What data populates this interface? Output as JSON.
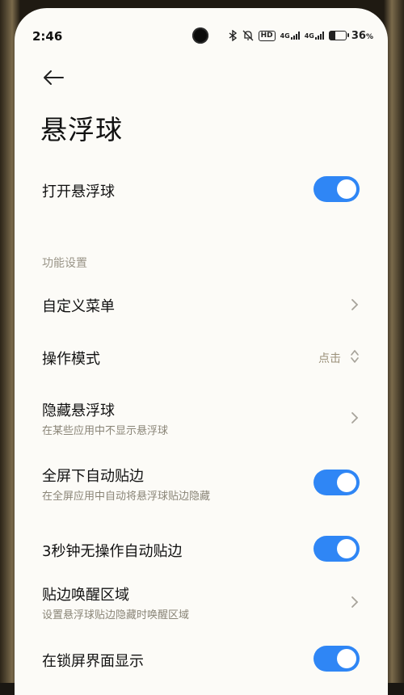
{
  "status_bar": {
    "time": "2:46",
    "hd": "HD",
    "sig1": "4G",
    "sig2": "4G",
    "battery": "36"
  },
  "page": {
    "title": "悬浮球"
  },
  "main_toggle": {
    "label": "打开悬浮球",
    "on": true
  },
  "section": {
    "title": "功能设置"
  },
  "items": [
    {
      "label": "自定义菜单",
      "type": "link"
    },
    {
      "label": "操作模式",
      "type": "select",
      "value": "点击"
    },
    {
      "label": "隐藏悬浮球",
      "subtitle": "在某些应用中不显示悬浮球",
      "type": "link"
    },
    {
      "label": "全屏下自动贴边",
      "subtitle": "在全屏应用中自动将悬浮球贴边隐藏",
      "type": "toggle",
      "on": true
    },
    {
      "label": "3秒钟无操作自动贴边",
      "type": "toggle",
      "on": true
    },
    {
      "label": "贴边唤醒区域",
      "subtitle": "设置悬浮球贴边隐藏时唤醒区域",
      "type": "link"
    },
    {
      "label": "在锁屏界面显示",
      "type": "toggle",
      "on": true
    }
  ],
  "colors": {
    "accent": "#2f86f5",
    "background": "#fcfbf7"
  }
}
